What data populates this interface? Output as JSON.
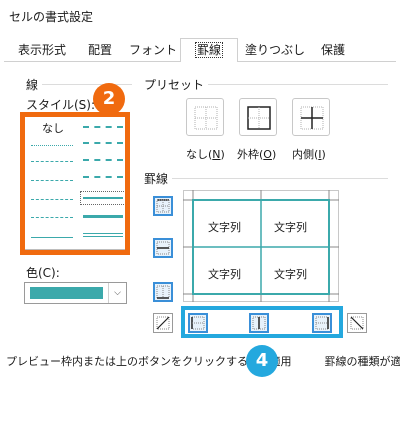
{
  "dialog": {
    "title": "セルの書式設定"
  },
  "tabs": [
    {
      "label": "表示形式",
      "active": false
    },
    {
      "label": "配置",
      "active": false
    },
    {
      "label": "フォント",
      "active": false
    },
    {
      "label": "罫線",
      "active": true
    },
    {
      "label": "塗りつぶし",
      "active": false
    },
    {
      "label": "保護",
      "active": false
    }
  ],
  "line_group": {
    "label": "線",
    "style_label": "スタイル(S):",
    "style_label_key": "S",
    "none_label": "なし",
    "color_label": "色(C):",
    "color_value": "#3ba9ab"
  },
  "preset_group": {
    "label": "プリセット",
    "none": {
      "label": "なし",
      "key": "N"
    },
    "outline": {
      "label": "外枠",
      "key": "O"
    },
    "inside": {
      "label": "内側",
      "key": "I"
    }
  },
  "border_group": {
    "label": "罫線",
    "cell_text": "文字列"
  },
  "annotations": {
    "step2": "2",
    "step4": "4",
    "color_orange": "#f06a0f",
    "color_blue": "#24a8de"
  },
  "footer": {
    "hint": "プレビュー枠内または上のボタンをクリックすると、適用　　　罫線の種類が適用されます。"
  }
}
